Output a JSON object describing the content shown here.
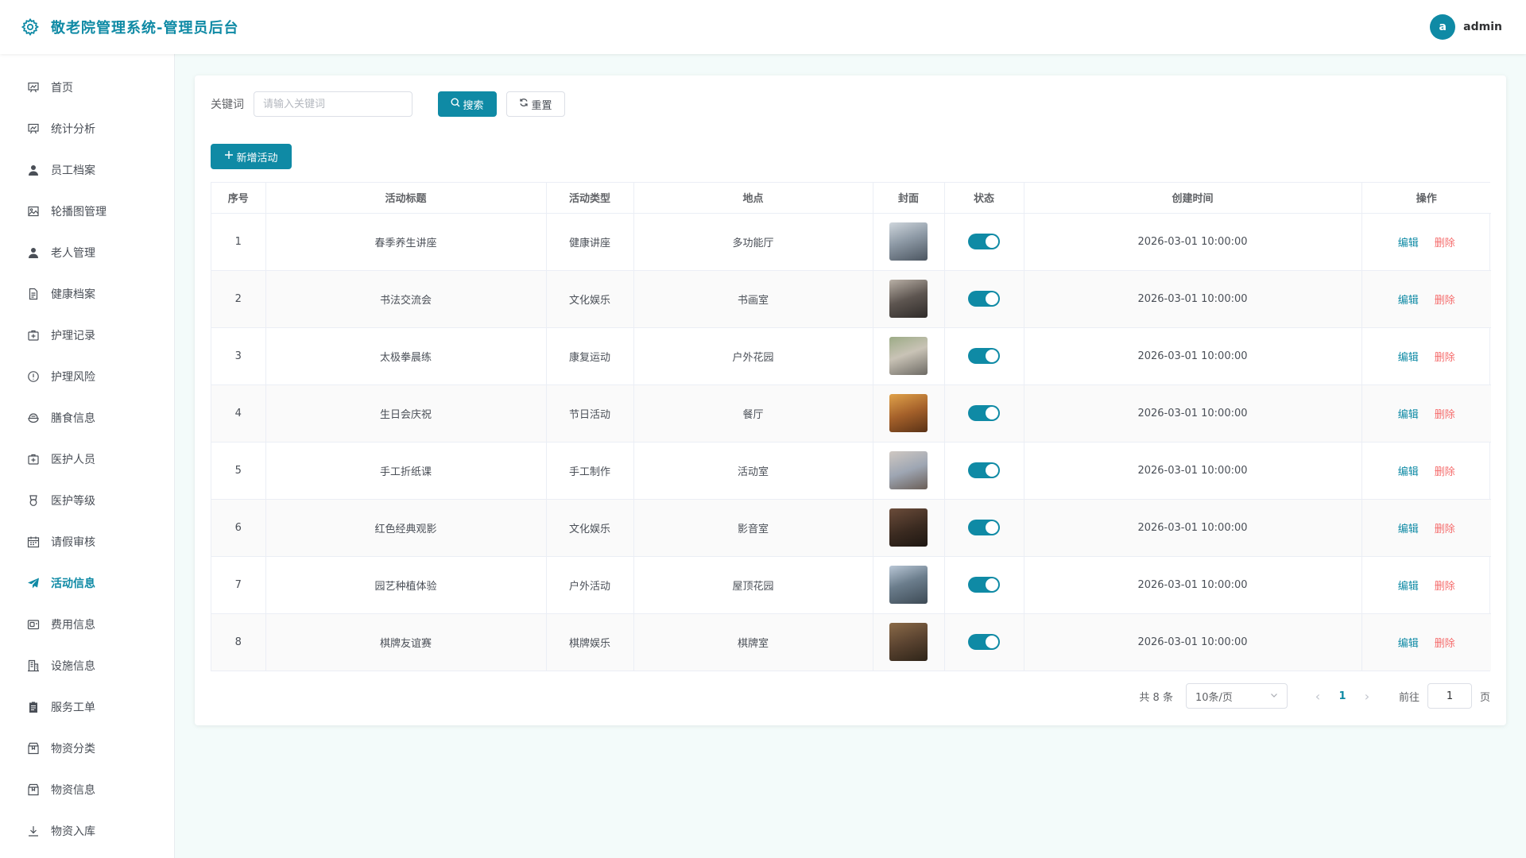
{
  "header": {
    "title": "敬老院管理系统-管理员后台",
    "avatar_letter": "a",
    "username": "admin"
  },
  "sidebar": {
    "items": [
      {
        "label": "首页",
        "icon": "chart-board-icon"
      },
      {
        "label": "统计分析",
        "icon": "chart-board-icon"
      },
      {
        "label": "员工档案",
        "icon": "user-icon"
      },
      {
        "label": "轮播图管理",
        "icon": "picture-icon"
      },
      {
        "label": "老人管理",
        "icon": "user-icon"
      },
      {
        "label": "健康档案",
        "icon": "document-icon"
      },
      {
        "label": "护理记录",
        "icon": "first-aid-kit-icon"
      },
      {
        "label": "护理风险",
        "icon": "warning-icon"
      },
      {
        "label": "膳食信息",
        "icon": "bowl-icon"
      },
      {
        "label": "医护人员",
        "icon": "first-aid-kit-icon"
      },
      {
        "label": "医护等级",
        "icon": "medal-icon"
      },
      {
        "label": "请假审核",
        "icon": "calendar-icon"
      },
      {
        "label": "活动信息",
        "icon": "promotion-icon"
      },
      {
        "label": "费用信息",
        "icon": "wallet-icon"
      },
      {
        "label": "设施信息",
        "icon": "office-building-icon"
      },
      {
        "label": "服务工单",
        "icon": "tickets-icon"
      },
      {
        "label": "物资分类",
        "icon": "box-icon"
      },
      {
        "label": "物资信息",
        "icon": "box-icon"
      },
      {
        "label": "物资入库",
        "icon": "download-icon"
      }
    ],
    "active_index": 12
  },
  "search": {
    "label": "关键词",
    "placeholder": "请输入关键词",
    "value": "",
    "search_button": "搜索",
    "reset_button": "重置"
  },
  "toolbar": {
    "add_button": "新增活动"
  },
  "table": {
    "columns": [
      "序号",
      "活动标题",
      "活动类型",
      "地点",
      "封面",
      "状态",
      "创建时间",
      "操作"
    ],
    "rows": [
      {
        "index": "1",
        "title": "春季养生讲座",
        "type": "健康讲座",
        "location": "多功能厅",
        "status_on": true,
        "created": "2026-03-01 10:00:00"
      },
      {
        "index": "2",
        "title": "书法交流会",
        "type": "文化娱乐",
        "location": "书画室",
        "status_on": true,
        "created": "2026-03-01 10:00:00"
      },
      {
        "index": "3",
        "title": "太极拳晨练",
        "type": "康复运动",
        "location": "户外花园",
        "status_on": true,
        "created": "2026-03-01 10:00:00"
      },
      {
        "index": "4",
        "title": "生日会庆祝",
        "type": "节日活动",
        "location": "餐厅",
        "status_on": true,
        "created": "2026-03-01 10:00:00"
      },
      {
        "index": "5",
        "title": "手工折纸课",
        "type": "手工制作",
        "location": "活动室",
        "status_on": true,
        "created": "2026-03-01 10:00:00"
      },
      {
        "index": "6",
        "title": "红色经典观影",
        "type": "文化娱乐",
        "location": "影音室",
        "status_on": true,
        "created": "2026-03-01 10:00:00"
      },
      {
        "index": "7",
        "title": "园艺种植体验",
        "type": "户外活动",
        "location": "屋顶花园",
        "status_on": true,
        "created": "2026-03-01 10:00:00"
      },
      {
        "index": "8",
        "title": "棋牌友谊赛",
        "type": "棋牌娱乐",
        "location": "棋牌室",
        "status_on": true,
        "created": "2026-03-01 10:00:00"
      }
    ],
    "edit_label": "编辑",
    "delete_label": "删除"
  },
  "pagination": {
    "total_text": "共 8 条",
    "page_size": "10条/页",
    "current_page": "1",
    "goto_label": "前往",
    "goto_value": "1",
    "page_suffix": "页"
  },
  "colors": {
    "accent": "#0f8aa5",
    "danger": "#f56c6c",
    "background": "#f3fbfa"
  }
}
